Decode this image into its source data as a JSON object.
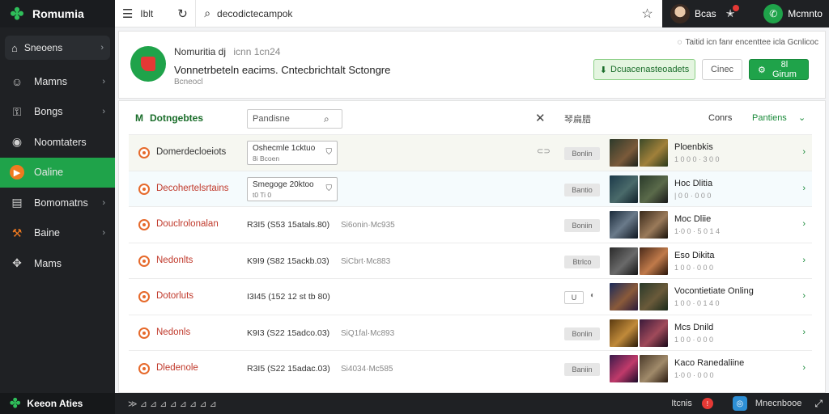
{
  "app": {
    "name": "Romumia",
    "footer_name": "Keeon Aties"
  },
  "sidebar": {
    "search_label": "Sneoens",
    "items": [
      {
        "label": "Mamns",
        "icon": "person-icon"
      },
      {
        "label": "Bongs",
        "icon": "lock-icon"
      },
      {
        "label": "Noomtaters",
        "icon": "camera-icon"
      },
      {
        "label": "Oaline",
        "icon": "youtube-icon",
        "active": true
      },
      {
        "label": "Bomomatns",
        "icon": "document-icon"
      },
      {
        "label": "Baine",
        "icon": "pickaxe-icon"
      },
      {
        "label": "Mams",
        "icon": "gamepad-icon"
      }
    ]
  },
  "topbar": {
    "text_button": "Iblt",
    "search_value": "decodictecampok",
    "user_name": "Bcas",
    "account_name": "Mcmnto"
  },
  "header": {
    "title": "Nomuritia dj",
    "title_code": "icnn 1cn24",
    "subtitle": "Vonnetrbeteln eacims.  Cntecbrichtalt Sctongre",
    "meta": "Bcneocl",
    "note": "Taitid icn fanr  encenttee icla Gcnlicoc",
    "btn_light": "Dcuacenasteoadets",
    "btn_outline": "Cinec",
    "btn_green": "8l Girum"
  },
  "panel": {
    "title_icon": "M",
    "title": "Dotngebtes",
    "filter_value": "Pandisne",
    "grid_label": "琴扁腊",
    "sort_label": "Conrs",
    "more_label": "Pantiens"
  },
  "rows": [
    {
      "name": "Domerdecloeiots",
      "chip_l1": "Oshecmle  1cktuo",
      "chip_l2": "8i         Bcoen",
      "cc": "⊂⊃",
      "tag": "Bonlin",
      "tname": "Ploenbkis",
      "tsub": "1 0 0 0 · 3 0 0"
    },
    {
      "name": "Decohertelsrtains",
      "chip_l1": "Smegoge   20ktoo",
      "chip_l2": "t0         Ti 0",
      "tag": "Bantio",
      "tname": "Hoc Dlitia",
      "tsub": "| 0 0 · 0 0 0"
    },
    {
      "name": "Douclrolonalan",
      "val": "R3I5  (S53  15atals.80)",
      "extra": "Si6onin·Mc935",
      "tag": "Boniin",
      "tname": "Moc Dliie",
      "tsub": "1·0 0 · 5 0 1 4"
    },
    {
      "name": "Nedonlts",
      "val": "K9I9  (S82  15ackb.03)",
      "extra": "SiCbrt·Mc883",
      "tag": "Btrlco",
      "tname": "Eso Dikita",
      "tsub": "1 0 0 · 0 0 0"
    },
    {
      "name": "Dotorluts",
      "val": "I3I45  (152  12 st tb 80)",
      "tag": "U",
      "tag_small": true,
      "tag_icon": "◐",
      "tname": "Vocontietiate Onling",
      "tsub": "1 0 0 · 0 1 4 0"
    },
    {
      "name": "Nedonls",
      "val": "K9I3  (S22  15adco.03)",
      "extra": "SiQ1fal·Mc893",
      "tag": "Bonlin",
      "tname": "Mcs Dnild",
      "tsub": "1 0 0 · 0 0 0"
    },
    {
      "name": "Dledenole",
      "val": "R3I5  (S22  15adac.03)",
      "extra": "Si4034·Mc585",
      "tag": "Baniin",
      "tname": "Kaco Ranedaliine",
      "tsub": "1·0 0 · 0 0 0"
    }
  ],
  "bottombar": {
    "left_text": "≫ ⊿ ⊿ ⊿ ⊿ ⊿ ⊿ ⊿ ⊿",
    "status": "Itcnis",
    "name": "Mnecnbooe"
  },
  "colors": {
    "brand_green": "#1fa34a",
    "sidebar_bg": "#1f2124",
    "alert_red": "#e53935",
    "accent_orange": "#e66a2c"
  }
}
